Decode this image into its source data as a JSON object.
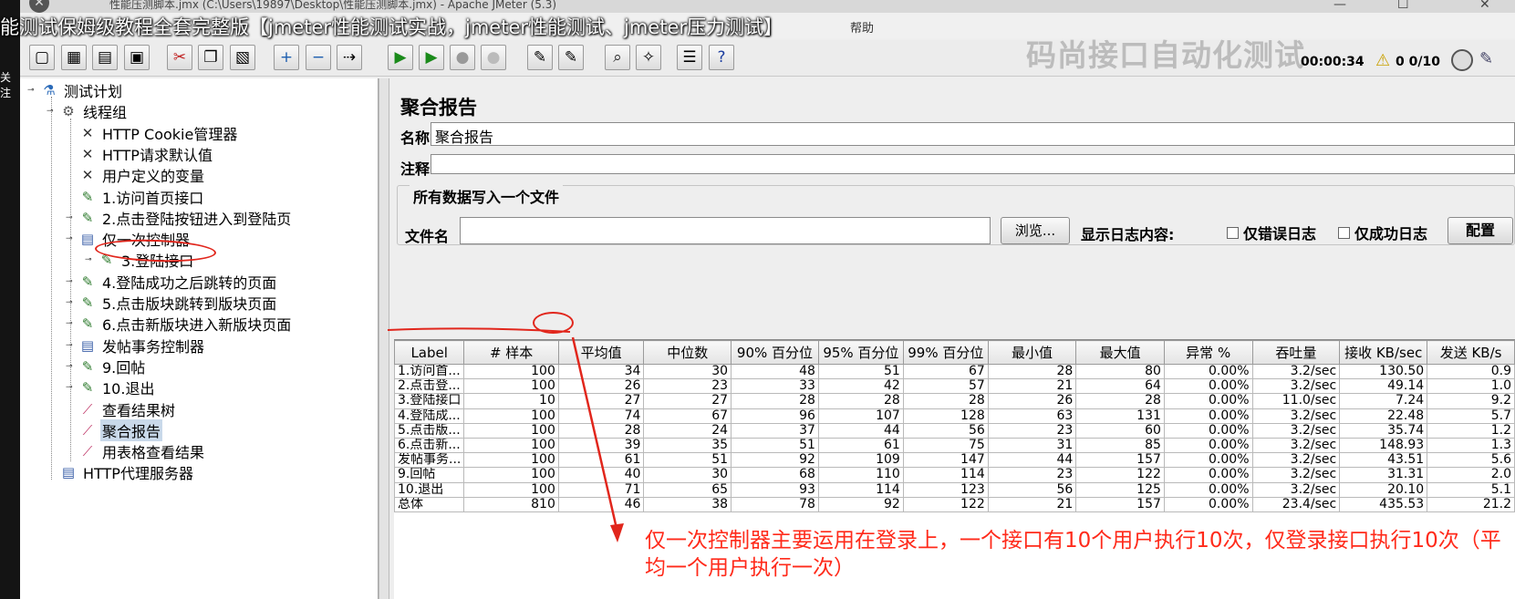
{
  "window": {
    "title": "性能压测脚本.jmx (C:\\Users\\19897\\Desktop\\性能压测脚本.jmx) - Apache JMeter (5.3)",
    "minimize": "—",
    "maximize": "☐",
    "close": "✕"
  },
  "overlay": {
    "video_title": "能测试保姆级教程全套完整版【jmeter性能测试实战，jmeter性能测试、jmeter压力测试】",
    "left_text": "关注",
    "watermark": "码尚接口自动化测试",
    "close_glyph": "✕"
  },
  "menubar": {
    "help": "帮助"
  },
  "status": {
    "timer": "00:00:34",
    "threads": "0  0/10"
  },
  "toolbar": {
    "buttons": [
      {
        "name": "new-icon",
        "glyph": "▢"
      },
      {
        "name": "templates-icon",
        "glyph": "▦"
      },
      {
        "name": "open-icon",
        "glyph": "▤"
      },
      {
        "name": "save-icon",
        "glyph": "▣"
      },
      {
        "name": "cut-icon",
        "glyph": "✂"
      },
      {
        "name": "copy-icon",
        "glyph": "❐"
      },
      {
        "name": "paste-icon",
        "glyph": "▧"
      },
      {
        "name": "expand-icon",
        "glyph": "+"
      },
      {
        "name": "collapse-icon",
        "glyph": "−"
      },
      {
        "name": "toggle-icon",
        "glyph": "⇢"
      },
      {
        "name": "start-icon",
        "glyph": "▶"
      },
      {
        "name": "start-no-pause-icon",
        "glyph": "▶"
      },
      {
        "name": "stop-icon",
        "glyph": "●"
      },
      {
        "name": "shutdown-icon",
        "glyph": "●"
      },
      {
        "name": "clear-icon",
        "glyph": "✎"
      },
      {
        "name": "clear-all-icon",
        "glyph": "✎"
      },
      {
        "name": "search-icon",
        "glyph": "⌕"
      },
      {
        "name": "reset-search-icon",
        "glyph": "✧"
      },
      {
        "name": "function-helper-icon",
        "glyph": "☰"
      },
      {
        "name": "help-icon",
        "glyph": "?"
      }
    ]
  },
  "tree": {
    "nodes": [
      {
        "label": "测试计划",
        "icon": "flask-icon",
        "glyph": "⚗"
      },
      {
        "label": "线程组",
        "icon": "gear-icon",
        "glyph": "⚙"
      },
      {
        "label": "HTTP Cookie管理器",
        "icon": "wrench-icon",
        "glyph": "✕"
      },
      {
        "label": "HTTP请求默认值",
        "icon": "wrench-icon",
        "glyph": "✕"
      },
      {
        "label": "用户定义的变量",
        "icon": "wrench-icon",
        "glyph": "✕"
      },
      {
        "label": "1.访问首页接口",
        "icon": "pipette-icon",
        "glyph": "✎"
      },
      {
        "label": "2.点击登陆按钮进入到登陆页",
        "icon": "pipette-icon",
        "glyph": "✎"
      },
      {
        "label": "仅一次控制器",
        "icon": "controller-icon",
        "glyph": "▤"
      },
      {
        "label": "3.登陆接口",
        "icon": "pipette-icon",
        "glyph": "✎"
      },
      {
        "label": "4.登陆成功之后跳转的页面",
        "icon": "pipette-icon",
        "glyph": "✎"
      },
      {
        "label": "5.点击版块跳转到版块页面",
        "icon": "pipette-icon",
        "glyph": "✎"
      },
      {
        "label": "6.点击新版块进入新版块页面",
        "icon": "pipette-icon",
        "glyph": "✎"
      },
      {
        "label": "发帖事务控制器",
        "icon": "controller-icon",
        "glyph": "▤"
      },
      {
        "label": "9.回帖",
        "icon": "pipette-icon",
        "glyph": "✎"
      },
      {
        "label": "10.退出",
        "icon": "pipette-icon",
        "glyph": "✎"
      },
      {
        "label": "查看结果树",
        "icon": "chart-icon",
        "glyph": "⟋"
      },
      {
        "label": "聚合报告",
        "icon": "chart-icon",
        "glyph": "⟋"
      },
      {
        "label": "用表格查看结果",
        "icon": "chart-icon",
        "glyph": "⟋"
      },
      {
        "label": "HTTP代理服务器",
        "icon": "controller-icon",
        "glyph": "▤"
      }
    ]
  },
  "panel": {
    "title": "聚合报告",
    "name_label": "名称:",
    "name_value": "聚合报告",
    "comment_label": "注释:",
    "comment_value": "",
    "file_group_title": "所有数据写入一个文件",
    "filename_label": "文件名",
    "filename_value": "",
    "browse_button": "浏览...",
    "log_label": "显示日志内容:",
    "errors_only": "仅错误日志",
    "success_only": "仅成功日志",
    "configure_button": "配置"
  },
  "table": {
    "headers": [
      "Label",
      "# 样本",
      "平均值",
      "中位数",
      "90% 百分位",
      "95% 百分位",
      "99% 百分位",
      "最小值",
      "最大值",
      "异常 %",
      "吞吐量",
      "接收 KB/sec",
      "发送 KB/s"
    ],
    "rows": [
      [
        "1.访问首...",
        "100",
        "34",
        "30",
        "48",
        "51",
        "67",
        "28",
        "80",
        "0.00%",
        "3.2/sec",
        "130.50",
        "0.9"
      ],
      [
        "2.点击登...",
        "100",
        "26",
        "23",
        "33",
        "42",
        "57",
        "21",
        "64",
        "0.00%",
        "3.2/sec",
        "49.14",
        "1.0"
      ],
      [
        "3.登陆接口",
        "10",
        "27",
        "27",
        "28",
        "28",
        "28",
        "26",
        "28",
        "0.00%",
        "11.0/sec",
        "7.24",
        "9.2"
      ],
      [
        "4.登陆成...",
        "100",
        "74",
        "67",
        "96",
        "107",
        "128",
        "63",
        "131",
        "0.00%",
        "3.2/sec",
        "22.48",
        "5.7"
      ],
      [
        "5.点击版...",
        "100",
        "28",
        "24",
        "37",
        "44",
        "56",
        "23",
        "60",
        "0.00%",
        "3.2/sec",
        "35.74",
        "1.2"
      ],
      [
        "6.点击新...",
        "100",
        "39",
        "35",
        "51",
        "61",
        "75",
        "31",
        "85",
        "0.00%",
        "3.2/sec",
        "148.93",
        "1.3"
      ],
      [
        "发帖事务...",
        "100",
        "61",
        "51",
        "92",
        "109",
        "147",
        "44",
        "157",
        "0.00%",
        "3.2/sec",
        "43.51",
        "5.6"
      ],
      [
        "9.回帖",
        "100",
        "40",
        "30",
        "68",
        "110",
        "114",
        "23",
        "122",
        "0.00%",
        "3.2/sec",
        "31.31",
        "2.0"
      ],
      [
        "10.退出",
        "100",
        "71",
        "65",
        "93",
        "114",
        "123",
        "56",
        "125",
        "0.00%",
        "3.2/sec",
        "20.10",
        "5.1"
      ],
      [
        "总体",
        "810",
        "46",
        "38",
        "78",
        "92",
        "122",
        "21",
        "157",
        "0.00%",
        "23.4/sec",
        "435.53",
        "21.2"
      ]
    ]
  },
  "annotation": {
    "text": "仅一次控制器主要运用在登录上，一个接口有10个用户执行10次，仅登录接口执行10次（平均一个用户执行一次）",
    "color": "#ff2a1a"
  }
}
